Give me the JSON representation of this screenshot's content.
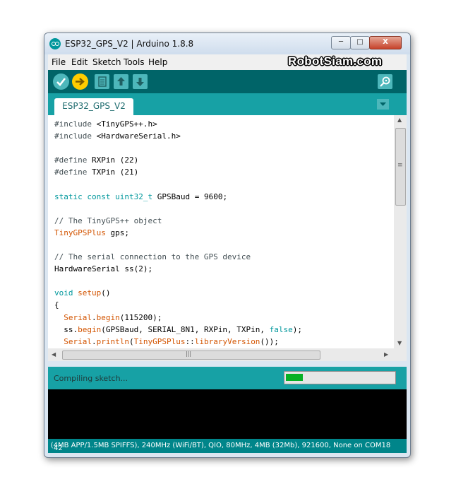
{
  "window": {
    "title": "ESP32_GPS_V2 | Arduino 1.8.8",
    "controls": {
      "minimize": "─",
      "maximize": "□",
      "close": "X"
    }
  },
  "menubar": {
    "items": [
      "File",
      "Edit",
      "Sketch",
      "Tools",
      "Help"
    ],
    "watermark": "RobotSiam.com"
  },
  "toolbar": {
    "buttons": [
      "verify-icon",
      "upload-icon",
      "new-icon",
      "open-icon",
      "save-icon",
      "serial-monitor-icon"
    ],
    "colors": {
      "toolbar_bg": "#006468",
      "verify": "#4db7bb",
      "upload": "#ffcc00"
    }
  },
  "tabs": [
    {
      "label": "ESP32_GPS_V2"
    }
  ],
  "editor": {
    "lines": [
      "#include <TinyGPS++.h>",
      "#include <HardwareSerial.h>",
      "",
      "#define RXPin (22)",
      "#define TXPin (21)",
      "",
      "static const uint32_t GPSBaud = 9600;",
      "",
      "// The TinyGPS++ object",
      "TinyGPSPlus gps;",
      "",
      "// The serial connection to the GPS device",
      "HardwareSerial ss(2);",
      "",
      "void setup()",
      "{",
      "  Serial.begin(115200);",
      "  ss.begin(GPSBaud, SERIAL_8N1, RXPin, TXPin, false);",
      "  Serial.println(TinyGPSPlus::libraryVersion());",
      "}"
    ]
  },
  "scrollbars": {
    "grip": "≡",
    "h_grip": "|||"
  },
  "status": {
    "message": "Compiling sketch...",
    "progress": 0.16
  },
  "footer": {
    "board_info": "(4MB APP/1.5MB SPIFFS), 240MHz (WiFi/BT), QIO, 80MHz, 4MB (32Mb), 921600, None on COM18",
    "line_number": "42"
  }
}
